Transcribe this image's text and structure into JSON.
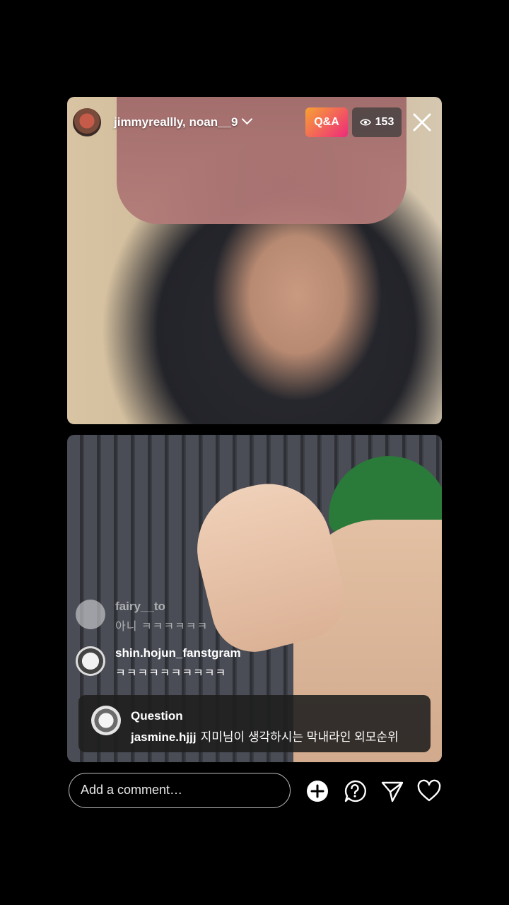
{
  "header": {
    "host_names": "jimmyreallly, noan__9",
    "qa_label": "Q&A",
    "viewer_count": "153"
  },
  "comments": [
    {
      "username": "fairy__to",
      "text": "아니 ㅋㅋㅋㅋㅋㅋ"
    },
    {
      "username": "shin.hojun_fanstgram",
      "text": "ㅋㅋㅋㅋㅋㅋㅋㅋㅋㅋ"
    }
  ],
  "question": {
    "title": "Question",
    "username": "jasmine.hjjj",
    "text": "지미님이 생각하시는 막내라인 외모순위"
  },
  "bottom_bar": {
    "comment_placeholder": "Add a comment…"
  },
  "icons": {
    "close": "close-icon",
    "eye": "eye-icon",
    "chevron": "chevron-down-icon",
    "add": "add-icon",
    "question": "question-icon",
    "send": "send-icon",
    "like": "heart-icon"
  }
}
